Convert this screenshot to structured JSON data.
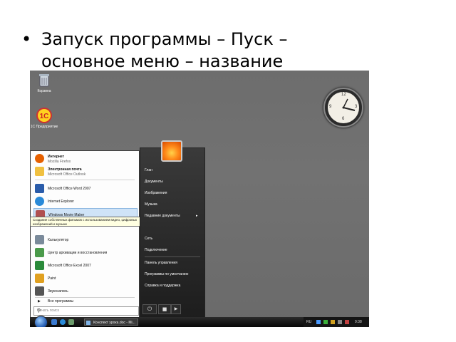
{
  "slide": {
    "bullet": "•",
    "line1": "Запуск программы – Пуск –",
    "line2": "основное меню – название"
  },
  "desktop": {
    "icons": [
      {
        "label": "Корзина",
        "icon": "recycle-bin-icon"
      },
      {
        "label": "1С Предприятие",
        "icon": "1c-icon"
      }
    ]
  },
  "clock": {
    "numerals": [
      "12",
      "3",
      "6",
      "9"
    ]
  },
  "start_menu": {
    "pinned": [
      {
        "title": "Интернет",
        "subtitle": "Mozilla Firefox",
        "icon": "firefox-icon",
        "color": "#e66000"
      },
      {
        "title": "Электронная почта",
        "subtitle": "Microsoft Office Outlook",
        "icon": "mail-icon",
        "color": "#f0c040"
      }
    ],
    "recent": [
      {
        "label": "Microsoft Office Word 2007",
        "icon": "word-icon",
        "color": "#2a5caa"
      },
      {
        "label": "Internet Explorer",
        "icon": "ie-icon",
        "color": "#2a8ad8"
      },
      {
        "label": "Windows Movie Maker",
        "icon": "movie-maker-icon",
        "color": "#b05050"
      },
      {
        "label": "Калькулятор",
        "icon": "calculator-icon",
        "color": "#7a8a9a"
      },
      {
        "label": "Центр архивации и восстановления",
        "icon": "backup-icon",
        "color": "#4a9a4a"
      },
      {
        "label": "Microsoft Office Excel 2007",
        "icon": "excel-icon",
        "color": "#2a8a3a"
      },
      {
        "label": "Paint",
        "icon": "paint-icon",
        "color": "#e0a020"
      },
      {
        "label": "Звукозапись",
        "icon": "microphone-icon",
        "color": "#555555"
      }
    ],
    "tooltip": "Создание собственных фильмов с использованием видео, цифровых изображений и музыки",
    "all_programs": "Все программы",
    "search_placeholder": "Начать поиск",
    "right": {
      "links": [
        "Глан",
        "Документы",
        "Изображения",
        "Музыка",
        "Недавние документы",
        "Сеть",
        "Подключение",
        "Панель управления",
        "Программы по умолчанию",
        "Справка и поддержка"
      ]
    }
  },
  "taskbar": {
    "active_window": "Конспект урока.doc - Mi...",
    "tray_lang": "RU",
    "tray_time": "9:38"
  }
}
